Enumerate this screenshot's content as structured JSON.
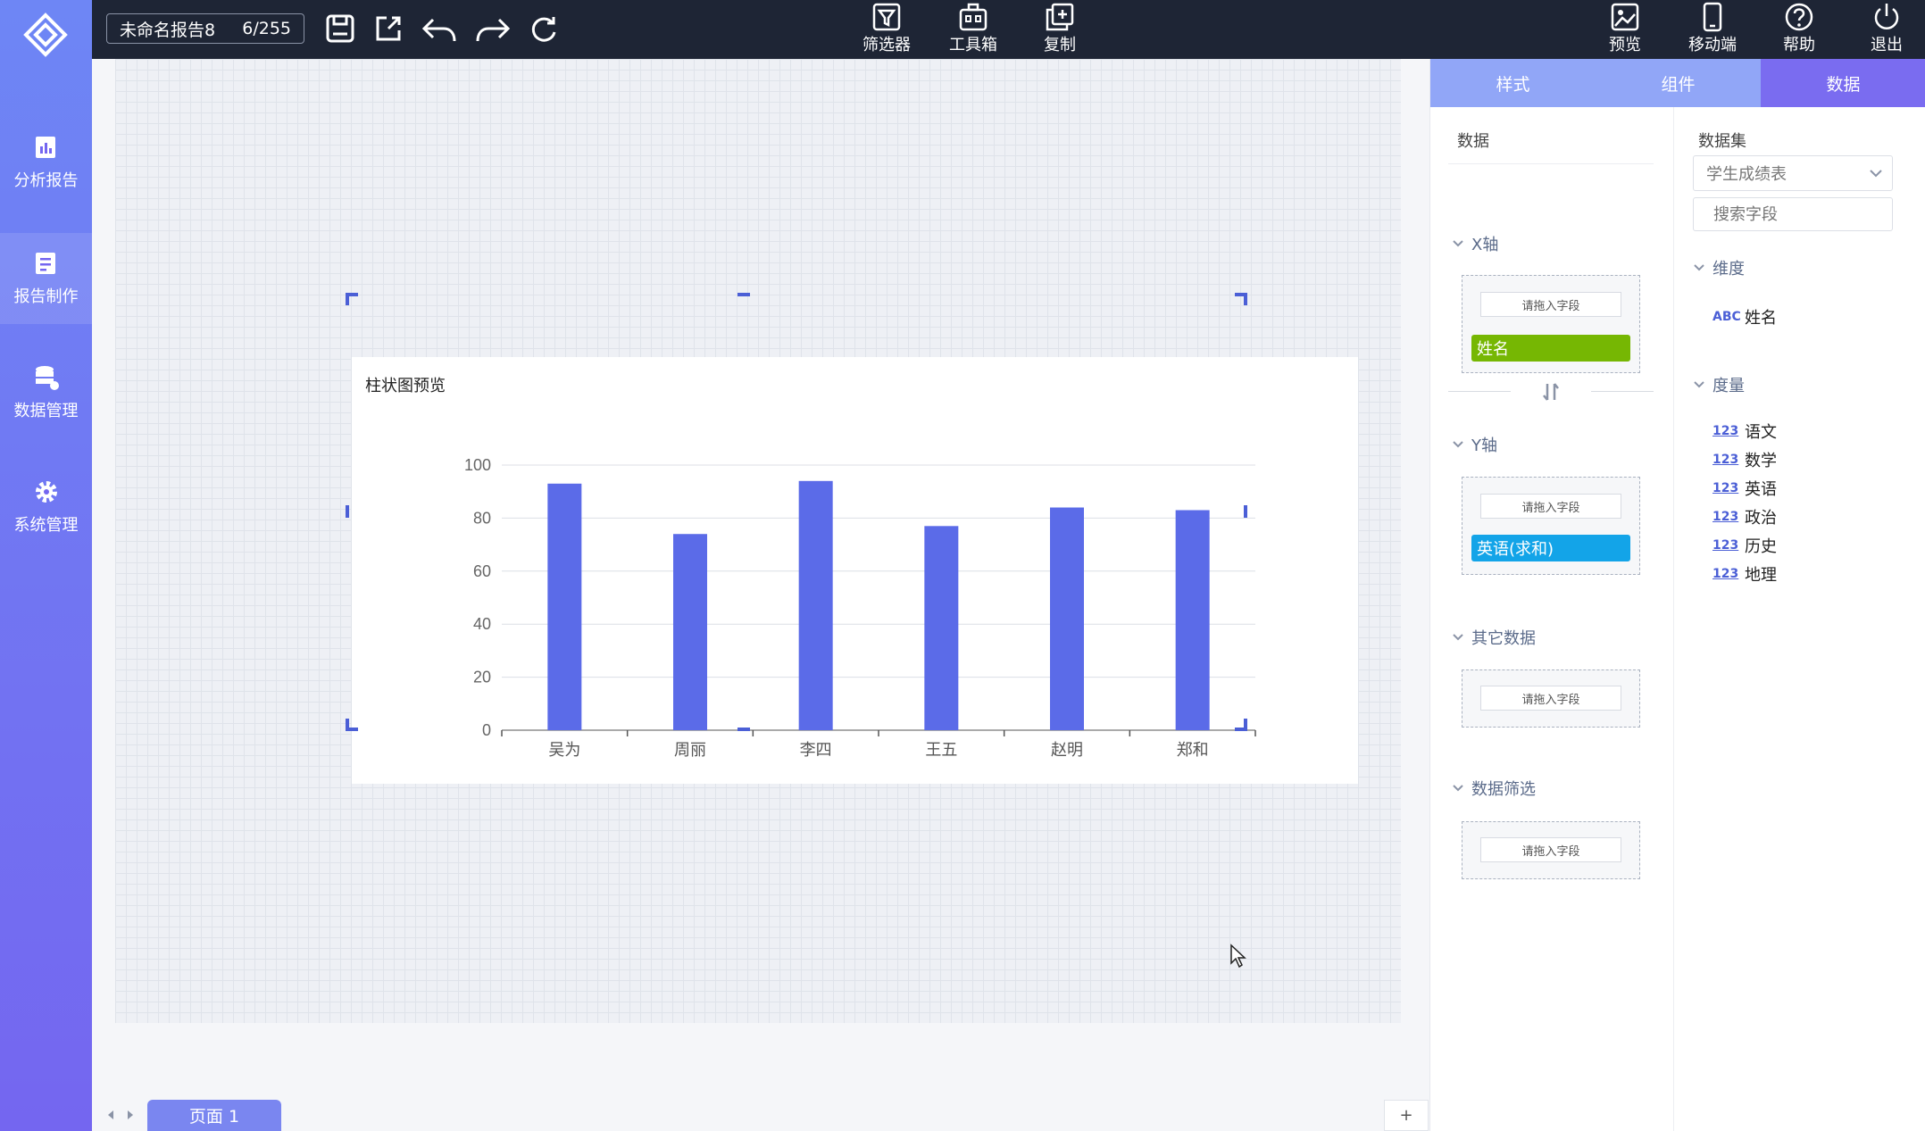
{
  "topbar": {
    "report_name": "未命名报告8",
    "report_count": "6/255",
    "center_tools": [
      {
        "label": "筛选器",
        "icon": "filter-icon"
      },
      {
        "label": "工具箱",
        "icon": "toolbox-icon"
      },
      {
        "label": "复制",
        "icon": "copy-icon"
      }
    ],
    "right_tools": [
      {
        "label": "预览",
        "icon": "preview-icon"
      },
      {
        "label": "移动端",
        "icon": "mobile-icon"
      },
      {
        "label": "帮助",
        "icon": "help-icon"
      },
      {
        "label": "退出",
        "icon": "power-icon"
      }
    ]
  },
  "sidebar": {
    "items": [
      {
        "label": "分析报告",
        "icon": "analysis-report-icon"
      },
      {
        "label": "报告制作",
        "icon": "report-edit-icon",
        "active": true
      },
      {
        "label": "数据管理",
        "icon": "database-icon"
      },
      {
        "label": "系统管理",
        "icon": "gear-icon"
      }
    ]
  },
  "chart": {
    "title": "柱状图预览",
    "bar_color": "#5b6be8"
  },
  "chart_data": {
    "type": "bar",
    "title": "柱状图预览",
    "categories": [
      "吴为",
      "周丽",
      "李四",
      "王五",
      "赵明",
      "郑和"
    ],
    "values": [
      93,
      74,
      94,
      77,
      84,
      83
    ],
    "yticks": [
      "0",
      "20",
      "40",
      "60",
      "80",
      "100"
    ],
    "ylim": [
      0,
      100
    ],
    "xlabel": "",
    "ylabel": "",
    "grid": true
  },
  "pages": {
    "current": "页面 1",
    "add": "+"
  },
  "right_panel": {
    "tabs": [
      "样式",
      "组件",
      "数据"
    ],
    "active_tab": "数据",
    "data_col": {
      "heading": "数据",
      "x_axis": {
        "title": "X轴",
        "hint": "请拖入字段",
        "field": "姓名",
        "field_color": "#76b703"
      },
      "y_axis": {
        "title": "Y轴",
        "hint": "请拖入字段",
        "field": "英语(求和)",
        "field_color": "#13a4e8"
      },
      "other": {
        "title": "其它数据",
        "hint": "请拖入字段"
      },
      "filter": {
        "title": "数据筛选",
        "hint": "请拖入字段"
      }
    },
    "dataset_col": {
      "heading": "数据集",
      "selected": "学生成绩表",
      "search_placeholder": "搜索字段",
      "dimension_title": "维度",
      "dimensions": [
        {
          "tag": "ABC",
          "name": "姓名"
        }
      ],
      "measure_title": "度量",
      "measures": [
        {
          "tag": "123",
          "name": "语文"
        },
        {
          "tag": "123",
          "name": "数学"
        },
        {
          "tag": "123",
          "name": "英语"
        },
        {
          "tag": "123",
          "name": "政治"
        },
        {
          "tag": "123",
          "name": "历史"
        },
        {
          "tag": "123",
          "name": "地理"
        }
      ]
    }
  }
}
